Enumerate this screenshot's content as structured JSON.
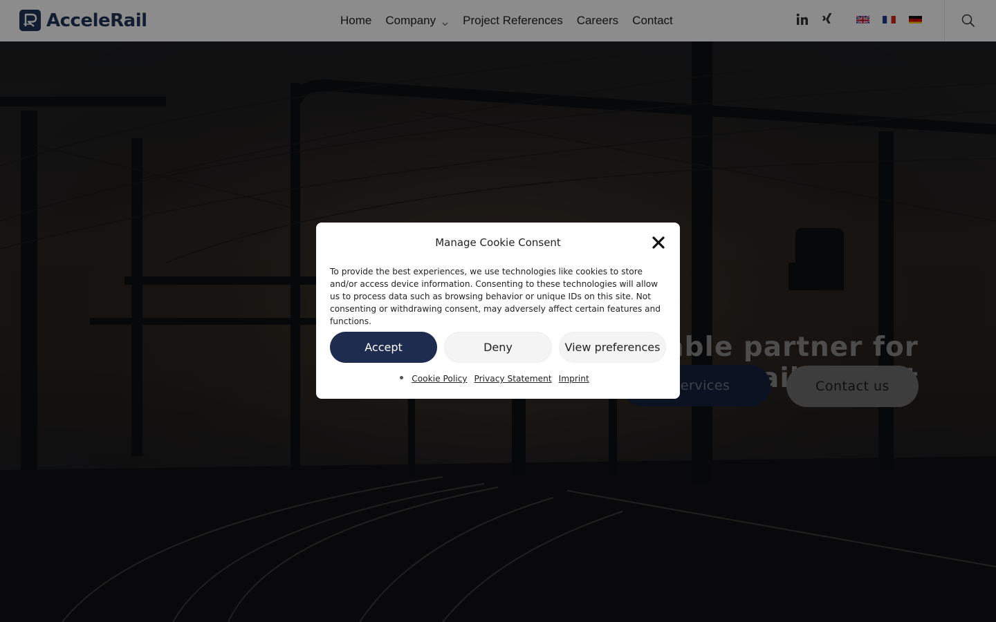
{
  "header": {
    "logo_text": "AcceleRail",
    "nav": [
      {
        "label": "Home"
      },
      {
        "label": "Company",
        "has_dropdown": true
      },
      {
        "label": "Project References"
      },
      {
        "label": "Careers"
      },
      {
        "label": "Contact"
      }
    ],
    "social": [
      "linkedin-icon",
      "xing-icon"
    ],
    "languages": [
      "English",
      "Français",
      "Deutsch"
    ],
    "search_icon": "search-icon"
  },
  "hero": {
    "heading_line1": "iable partner for",
    "heading_line2": "on in rail freight",
    "services_button": "r services",
    "contact_button": "Contact us"
  },
  "cookie_modal": {
    "title": "Manage Cookie Consent",
    "body": "To provide the best experiences, we use technologies like cookies to store and/or access device information. Consenting to these technologies will allow us to process data such as browsing behavior or unique IDs on this site. Not consenting or withdrawing consent, may adversely affect certain features and functions.",
    "accept_label": "Accept",
    "deny_label": "Deny",
    "preferences_label": "View preferences",
    "links": [
      "Cookie Policy",
      "Privacy Statement",
      "Imprint"
    ]
  },
  "colors": {
    "brand": "#23355a",
    "accept_bg": "#1e2d4f",
    "overlay": "rgba(0,0,0,0.45)"
  }
}
